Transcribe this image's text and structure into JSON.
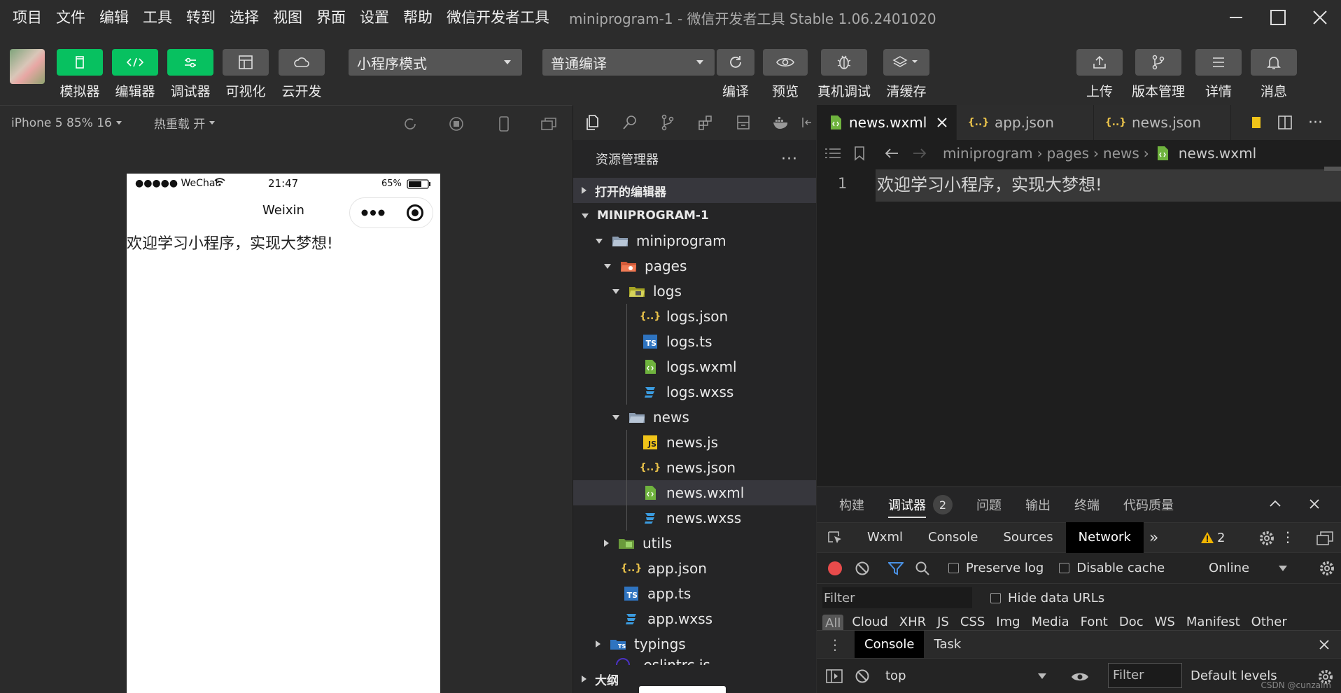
{
  "menu": [
    "项目",
    "文件",
    "编辑",
    "工具",
    "转到",
    "选择",
    "视图",
    "界面",
    "设置",
    "帮助",
    "微信开发者工具"
  ],
  "window_title": "miniprogram-1 - 微信开发者工具 Stable 1.06.2401020",
  "toolbar": {
    "simulator": "模拟器",
    "editor": "编辑器",
    "debugger": "调试器",
    "visual": "可视化",
    "cloud": "云开发",
    "mode": "小程序模式",
    "compile_mode": "普通编译",
    "compile": "编译",
    "preview": "预览",
    "real_debug": "真机调试",
    "clear_cache": "清缓存",
    "upload": "上传",
    "version": "版本管理",
    "details": "详情",
    "messages": "消息"
  },
  "sim_bar": {
    "device": "iPhone 5 85% 16",
    "hot_reload": "热重载 开"
  },
  "phone": {
    "carrier": "●●●●● WeChat",
    "time": "21:47",
    "battery": "65%",
    "nav_title": "Weixin",
    "content": "欢迎学习小程序，实现大梦想!"
  },
  "explorer": {
    "title": "资源管理器",
    "open_editors": "打开的编辑器",
    "project": "MINIPROGRAM-1",
    "tree": [
      {
        "name": "miniprogram"
      },
      {
        "name": "pages"
      },
      {
        "name": "logs"
      },
      {
        "name": "logs.json"
      },
      {
        "name": "logs.ts"
      },
      {
        "name": "logs.wxml"
      },
      {
        "name": "logs.wxss"
      },
      {
        "name": "news"
      },
      {
        "name": "news.js"
      },
      {
        "name": "news.json"
      },
      {
        "name": "news.wxml"
      },
      {
        "name": "news.wxss"
      },
      {
        "name": "utils"
      },
      {
        "name": "app.json"
      },
      {
        "name": "app.ts"
      },
      {
        "name": "app.wxss"
      },
      {
        "name": "typings"
      },
      {
        "name": ".eslintrc.js"
      }
    ],
    "outline": "大纲"
  },
  "editor": {
    "tabs": [
      "news.wxml",
      "app.json",
      "news.json"
    ],
    "breadcrumb": [
      "miniprogram",
      "pages",
      "news",
      "news.wxml"
    ],
    "line_number": "1",
    "code_line": "欢迎学习小程序，实现大梦想!"
  },
  "devtools": {
    "tabs": [
      "构建",
      "调试器",
      "问题",
      "输出",
      "终端",
      "代码质量"
    ],
    "debugger_badge": "2",
    "panels": [
      "Wxml",
      "Console",
      "Sources",
      "Network"
    ],
    "warning_count": "2",
    "preserve_log": "Preserve log",
    "disable_cache": "Disable cache",
    "throttle": "Online",
    "filter_placeholder": "Filter",
    "hide_data_urls": "Hide data URLs",
    "types": [
      "All",
      "Cloud",
      "XHR",
      "JS",
      "CSS",
      "Img",
      "Media",
      "Font",
      "Doc",
      "WS",
      "Manifest",
      "Other"
    ],
    "drawer_tabs": [
      "Console",
      "Task"
    ],
    "context": "top",
    "console_filter": "Filter",
    "levels": "Default levels"
  },
  "watermark": "CSDN @cunzaim"
}
